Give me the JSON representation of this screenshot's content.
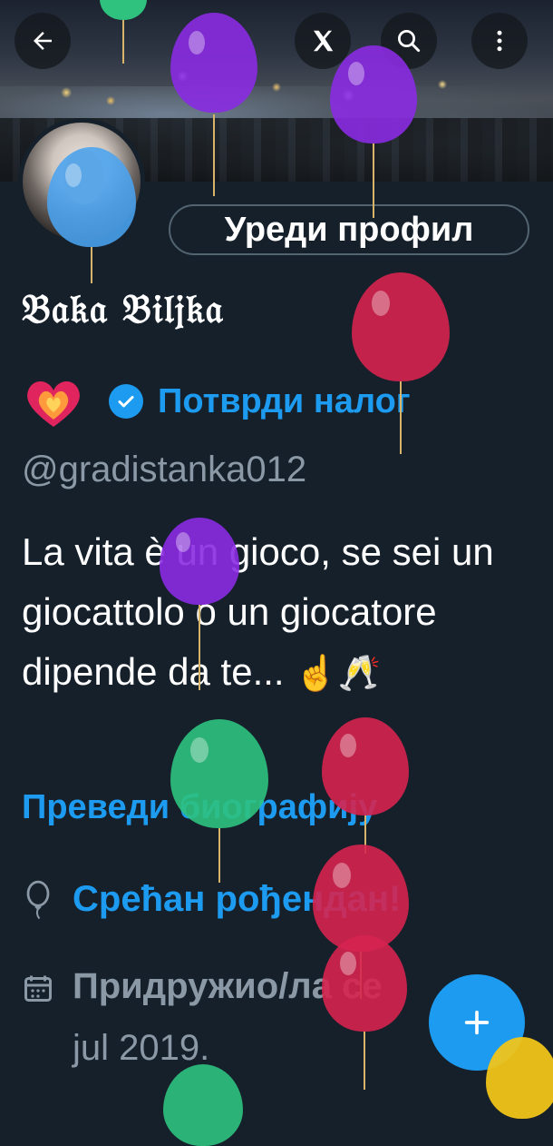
{
  "header": {
    "back_icon": "arrow-left-icon",
    "x_logo_icon": "x-logo-icon",
    "search_icon": "search-icon",
    "more_icon": "more-vertical-icon"
  },
  "profile": {
    "edit_button": "Уреди профил",
    "name": "𝔅𝔞𝔨𝔞 𝔅𝔦𝔩𝔧𝔨𝔞",
    "verify_link": "Потврди налог",
    "handle": "@gradistanka012",
    "bio": "La vita è un gioco, se sei un giocattolo o un giocatore dipende da te...",
    "bio_emoji": "☝🥂",
    "translate_link": "Преведи биографију",
    "birthday_text": "Срећан рођендан!",
    "joined_label": "Придружио/ла се",
    "joined_date": "jul 2019."
  },
  "icons": {
    "heart": "heart-on-fire-icon",
    "verified": "verified-badge-icon",
    "balloon": "balloon-icon",
    "calendar": "calendar-icon",
    "fab": "plus-icon"
  },
  "colors": {
    "background": "#15202b",
    "accent": "#1d9bf0",
    "muted": "#8b98a5"
  }
}
